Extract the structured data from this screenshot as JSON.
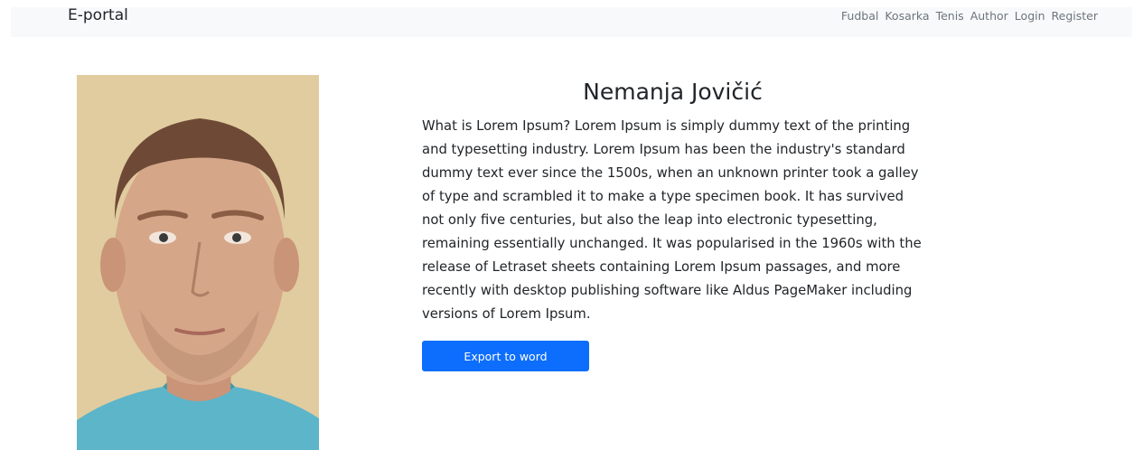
{
  "navbar": {
    "brand": "E-portal",
    "links": [
      "Fudbal",
      "Kosarka",
      "Tenis",
      "Author",
      "Login",
      "Register"
    ]
  },
  "profile": {
    "name": "Nemanja Jovičić",
    "photo_alt": "Portrait photo",
    "bio": "What is Lorem Ipsum? Lorem Ipsum is simply dummy text of the printing and typesetting industry. Lorem Ipsum has been the industry's standard dummy text ever since the 1500s, when an unknown printer took a galley of type and scrambled it to make a type specimen book. It has survived not only five centuries, but also the leap into electronic typesetting, remaining essentially unchanged. It was popularised in the 1960s with the release of Letraset sheets containing Lorem Ipsum passages, and more recently with desktop publishing software like Aldus PageMaker including versions of Lorem Ipsum.",
    "export_label": "Export to word"
  },
  "colors": {
    "navbar_bg": "#f8f9fa",
    "primary": "#0d6efd",
    "nav_link": "#6c757d",
    "text": "#212529"
  }
}
